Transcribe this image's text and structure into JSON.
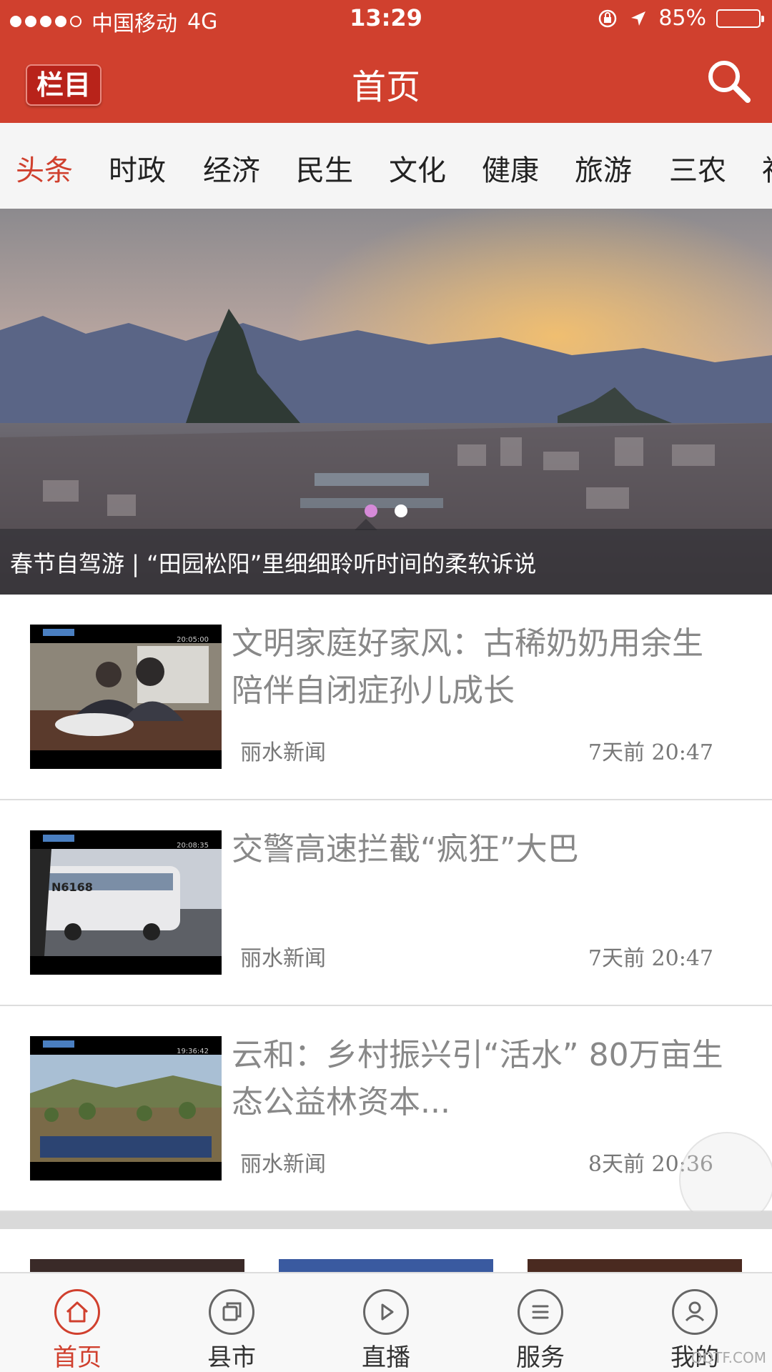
{
  "status_bar": {
    "carrier": "中国移动",
    "network": "4G",
    "time": "13:29",
    "battery_percent": "85%",
    "battery_level": 0.85
  },
  "header": {
    "menu_button_label": "栏目",
    "title": "首页"
  },
  "tabs": [
    {
      "label": "头条",
      "active": true
    },
    {
      "label": "时政",
      "active": false
    },
    {
      "label": "经济",
      "active": false
    },
    {
      "label": "民生",
      "active": false
    },
    {
      "label": "文化",
      "active": false
    },
    {
      "label": "健康",
      "active": false
    },
    {
      "label": "旅游",
      "active": false
    },
    {
      "label": "三农",
      "active": false
    },
    {
      "label": "社",
      "active": false
    }
  ],
  "banner": {
    "caption": "春节自驾游 | “田园松阳”里细细聆听时间的柔软诉说",
    "page_count": 2,
    "current_page": 1
  },
  "news": [
    {
      "title": "文明家庭好家风：古稀奶奶用余生陪伴自闭症孙儿成长",
      "source": "丽水新闻",
      "time": "7天前 20:47",
      "thumb_time": "20:05:00"
    },
    {
      "title": "交警高速拦截“疯狂”大巴",
      "source": "丽水新闻",
      "time": "7天前 20:47",
      "thumb_time": "20:08:35",
      "thumb_plate": "N6168"
    },
    {
      "title": "云和：乡村振兴引“活水” 80万亩生态公益林资本...",
      "source": "丽水新闻",
      "time": "8天前 20:36",
      "thumb_time": "19:36:42"
    }
  ],
  "bottom_nav": [
    {
      "label": "首页",
      "icon": "home-icon",
      "active": true
    },
    {
      "label": "县市",
      "icon": "layers-icon",
      "active": false
    },
    {
      "label": "直播",
      "icon": "play-icon",
      "active": false
    },
    {
      "label": "服务",
      "icon": "menu-icon",
      "active": false
    },
    {
      "label": "我的",
      "icon": "user-icon",
      "active": false
    }
  ],
  "colors": {
    "brand_red": "#d0402e",
    "tab_bg": "#f5f5f5",
    "active_dot": "#d68ad8"
  },
  "watermark": "QQTF.COM"
}
